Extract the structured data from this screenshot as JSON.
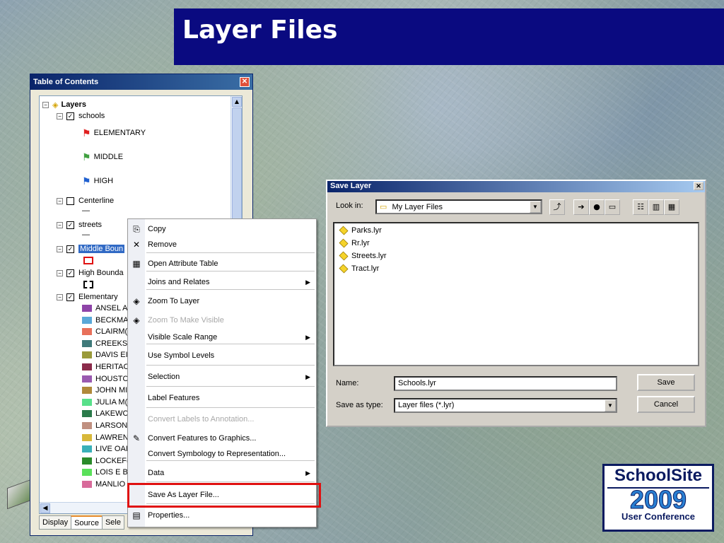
{
  "slide": {
    "title": "Layer Files"
  },
  "toc": {
    "header": "Table of Contents",
    "root": "Layers",
    "rows": [
      {
        "label": "schools",
        "checked": "☑"
      },
      {
        "label": "ELEMENTARY"
      },
      {
        "label": "MIDDLE"
      },
      {
        "label": "HIGH"
      },
      {
        "label": "Centerline",
        "checked": "☐"
      },
      {
        "label": "—"
      },
      {
        "label": "streets",
        "checked": "☑"
      },
      {
        "label": "—"
      },
      {
        "label": "Middle Boun",
        "checked": "☑"
      },
      {
        "label": "High Bounda",
        "checked": "☑"
      },
      {
        "label": "Elementary",
        "checked": "☑"
      }
    ],
    "elementary_items": [
      {
        "label": "ANSEL A",
        "color": "#8e44a8"
      },
      {
        "label": "BECKMA",
        "color": "#5aa8d8"
      },
      {
        "label": "CLAIRM(",
        "color": "#e8705a"
      },
      {
        "label": "CREEKSI",
        "color": "#3f7a7a"
      },
      {
        "label": "DAVIS EI",
        "color": "#9a9a3a"
      },
      {
        "label": "HERITAC",
        "color": "#8b2b4b"
      },
      {
        "label": "HOUSTC",
        "color": "#9a5ab0"
      },
      {
        "label": "JOHN MI",
        "color": "#b0893a"
      },
      {
        "label": "JULIA M(",
        "color": "#58e08a"
      },
      {
        "label": "LAKEWC",
        "color": "#2a7a4a"
      },
      {
        "label": "LARSON",
        "color": "#c09080"
      },
      {
        "label": "LAWREN",
        "color": "#d8b83a"
      },
      {
        "label": "LIVE OAI",
        "color": "#3ab0b8"
      },
      {
        "label": "LOCKEF(",
        "color": "#2a8a2a"
      },
      {
        "label": "LOIS E B",
        "color": "#5ae05a"
      },
      {
        "label": "MANLIO",
        "color": "#d86a9a"
      }
    ],
    "tabs": [
      "Display",
      "Source",
      "Sele"
    ]
  },
  "context_menu": {
    "items": [
      {
        "label": "Copy",
        "icon": "copy-icon",
        "glyph": "⎘"
      },
      {
        "label": "Remove",
        "icon": "remove-icon",
        "glyph": "✕"
      },
      {
        "label": "Open Attribute Table",
        "icon": "table-icon",
        "glyph": "▦"
      },
      {
        "label": "Joins and Relates",
        "icon": "",
        "glyph": "",
        "submenu": "▶"
      },
      {
        "label": "Zoom To Layer",
        "icon": "zoom-layer-icon",
        "glyph": "◈"
      },
      {
        "label": "Zoom To Make Visible",
        "icon": "zoom-visible-icon",
        "glyph": "◈"
      },
      {
        "label": "Visible Scale Range",
        "icon": "",
        "glyph": "",
        "submenu": "▶"
      },
      {
        "label": "Use Symbol Levels",
        "icon": "",
        "glyph": ""
      },
      {
        "label": "Selection",
        "icon": "",
        "glyph": "",
        "submenu": "▶"
      },
      {
        "label": "Label Features",
        "icon": "",
        "glyph": ""
      },
      {
        "label": "Convert Labels to Annotation...",
        "icon": "",
        "glyph": ""
      },
      {
        "label": "Convert Features to Graphics...",
        "icon": "convert-graphics-icon",
        "glyph": "✎"
      },
      {
        "label": "Convert Symbology to Representation...",
        "icon": "",
        "glyph": ""
      },
      {
        "label": "Data",
        "icon": "",
        "glyph": "",
        "submenu": "▶"
      },
      {
        "label": "Save As Layer File...",
        "icon": "",
        "glyph": ""
      },
      {
        "label": "Properties...",
        "icon": "properties-icon",
        "glyph": "▤"
      }
    ]
  },
  "save_dialog": {
    "title": "Save Layer",
    "look_in_label": "Look in:",
    "look_in_value": "My Layer Files",
    "files": [
      "Parks.lyr",
      "Rr.lyr",
      "Streets.lyr",
      "Tract.lyr"
    ],
    "name_label": "Name:",
    "name_value": "Schools.lyr",
    "type_label": "Save as type:",
    "type_value": "Layer files (*.lyr)",
    "save_btn": "Save",
    "cancel_btn": "Cancel"
  },
  "logo": {
    "top": "SchoolSite",
    "year": "2009",
    "bottom": "User Conference"
  }
}
